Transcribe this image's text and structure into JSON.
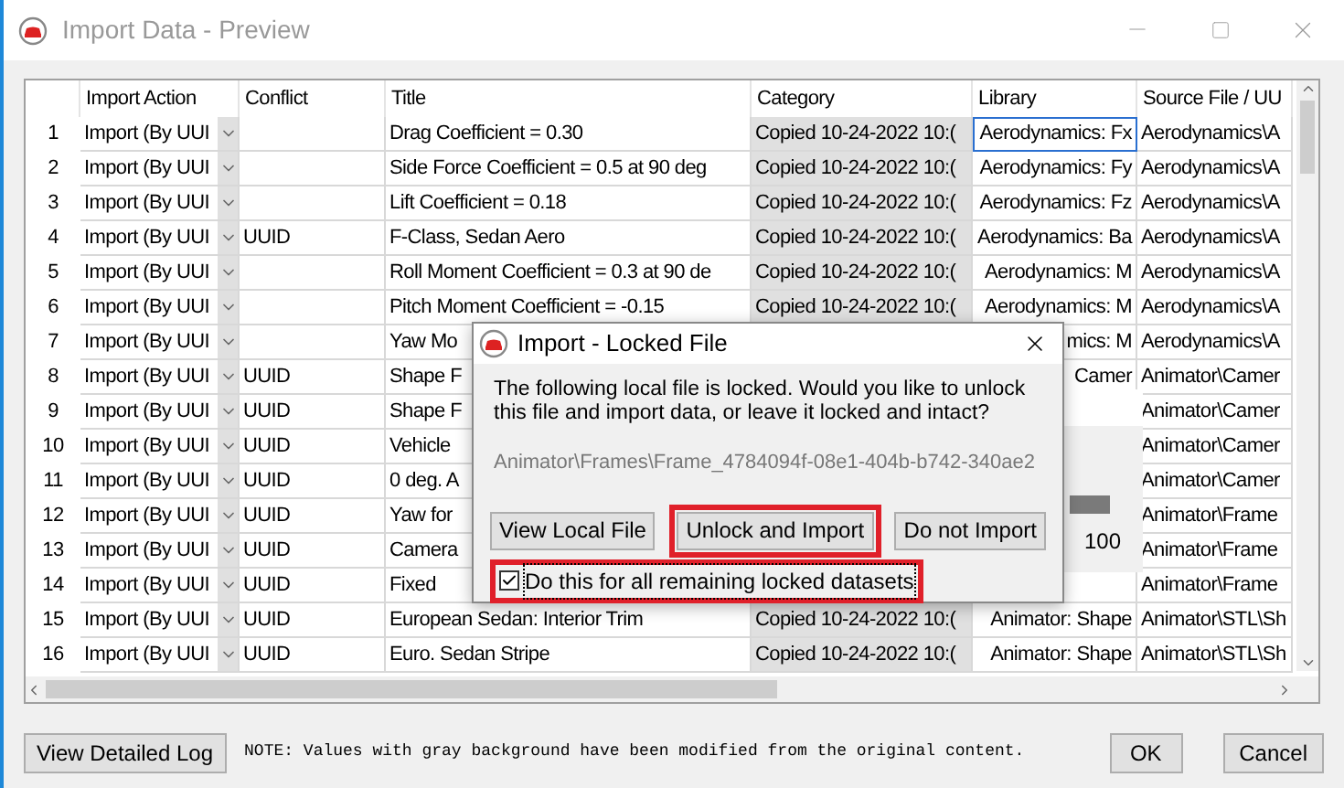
{
  "window": {
    "title": "Import Data - Preview"
  },
  "table": {
    "columns": [
      "Import Action",
      "Conflict",
      "Title",
      "Category",
      "Library",
      "Source File / UU"
    ],
    "rows": [
      {
        "number": "1",
        "action": "Import (By UUI",
        "conflict": "",
        "title": "Drag Coefficient = 0.30",
        "category": "Copied 10-24-2022 10:(",
        "modified": true,
        "library": "Aerodynamics: Fx",
        "library_focused": true,
        "source": "Aerodynamics\\A"
      },
      {
        "number": "2",
        "action": "Import (By UUI",
        "conflict": "",
        "title": "Side Force Coefficient = 0.5 at 90 deg",
        "category": "Copied 10-24-2022 10:(",
        "modified": true,
        "library": "Aerodynamics: Fy",
        "library_focused": false,
        "source": "Aerodynamics\\A"
      },
      {
        "number": "3",
        "action": "Import (By UUI",
        "conflict": "",
        "title": "Lift Coefficient = 0.18",
        "category": "Copied 10-24-2022 10:(",
        "modified": true,
        "library": "Aerodynamics: Fz",
        "library_focused": false,
        "source": "Aerodynamics\\A"
      },
      {
        "number": "4",
        "action": "Import (By UUI",
        "conflict": "UUID",
        "title": "F-Class, Sedan Aero",
        "category": "Copied 10-24-2022 10:(",
        "modified": true,
        "library": "Aerodynamics: Ba",
        "library_focused": false,
        "source": "Aerodynamics\\A"
      },
      {
        "number": "5",
        "action": "Import (By UUI",
        "conflict": "",
        "title": "Roll Moment Coefficient = 0.3 at 90 de",
        "category": "Copied 10-24-2022 10:(",
        "modified": true,
        "library": "Aerodynamics: M",
        "library_focused": false,
        "source": "Aerodynamics\\A"
      },
      {
        "number": "6",
        "action": "Import (By UUI",
        "conflict": "",
        "title": "Pitch Moment Coefficient = -0.15",
        "category": "Copied 10-24-2022 10:(",
        "modified": true,
        "library": "Aerodynamics: M",
        "library_focused": false,
        "source": "Aerodynamics\\A"
      },
      {
        "number": "7",
        "action": "Import (By UUI",
        "conflict": "",
        "title": "Yaw Mo",
        "category": "",
        "library": "mics: M",
        "library_focused": false,
        "source": "Aerodynamics\\A"
      },
      {
        "number": "8",
        "action": "Import (By UUI",
        "conflict": "UUID",
        "title": "Shape F",
        "category": "",
        "library": "Camer",
        "library_focused": false,
        "source": "Animator\\Camer"
      },
      {
        "number": "9",
        "action": "Import (By UUI",
        "conflict": "UUID",
        "title": "Shape F",
        "category": "",
        "library": "",
        "source": "Animator\\Camer"
      },
      {
        "number": "10",
        "action": "Import (By UUI",
        "conflict": "UUID",
        "title": "Vehicle",
        "category": "",
        "library": "",
        "source": "Animator\\Camer"
      },
      {
        "number": "11",
        "action": "Import (By UUI",
        "conflict": "UUID",
        "title": "0 deg. A",
        "category": "",
        "library": "",
        "source": "Animator\\Camer"
      },
      {
        "number": "12",
        "action": "Import (By UUI",
        "conflict": "UUID",
        "title": "Yaw for",
        "category": "",
        "library": "",
        "source": "Animator\\Frame"
      },
      {
        "number": "13",
        "action": "Import (By UUI",
        "conflict": "UUID",
        "title": "Camera",
        "category": "",
        "library": "",
        "source": "Animator\\Frame"
      },
      {
        "number": "14",
        "action": "Import (By UUI",
        "conflict": "UUID",
        "title": "Fixed",
        "category": "",
        "library": "",
        "library_focused": false,
        "source": "Animator\\Frame"
      },
      {
        "number": "15",
        "action": "Import (By UUI",
        "conflict": "UUID",
        "title": "European Sedan: Interior Trim",
        "category": "Copied 10-24-2022 10:(",
        "modified": true,
        "library": "Animator: Shape",
        "library_focused": false,
        "source": "Animator\\STL\\Sh"
      },
      {
        "number": "16",
        "action": "Import (By UUI",
        "conflict": "UUID",
        "title": "Euro. Sedan Stripe",
        "category": "Copied 10-24-2022 10:(",
        "modified": true,
        "library": "Animator: Shape",
        "library_focused": false,
        "source": "Animator\\STL\\Sh"
      }
    ]
  },
  "background_window": {
    "tick": "100"
  },
  "dialog": {
    "title": "Import - Locked File",
    "message": "The following local file is locked. Would you like to unlock this file and import data, or leave it locked and intact?",
    "path": "Animator\\Frames\\Frame_4784094f-08e1-404b-b742-340ae2",
    "buttons": [
      {
        "label": "View Local File",
        "highlighted": false
      },
      {
        "label": "Unlock and Import",
        "highlighted": true
      },
      {
        "label": "Do not Import",
        "highlighted": false
      }
    ],
    "checkbox": {
      "label": "Do this for all remaining locked datasets",
      "checked": true,
      "highlighted": true
    }
  },
  "footer": {
    "log_button": "View Detailed Log",
    "note": "NOTE: Values with gray background have been modified from the original content.",
    "buttons": [
      "OK",
      "Cancel"
    ]
  }
}
